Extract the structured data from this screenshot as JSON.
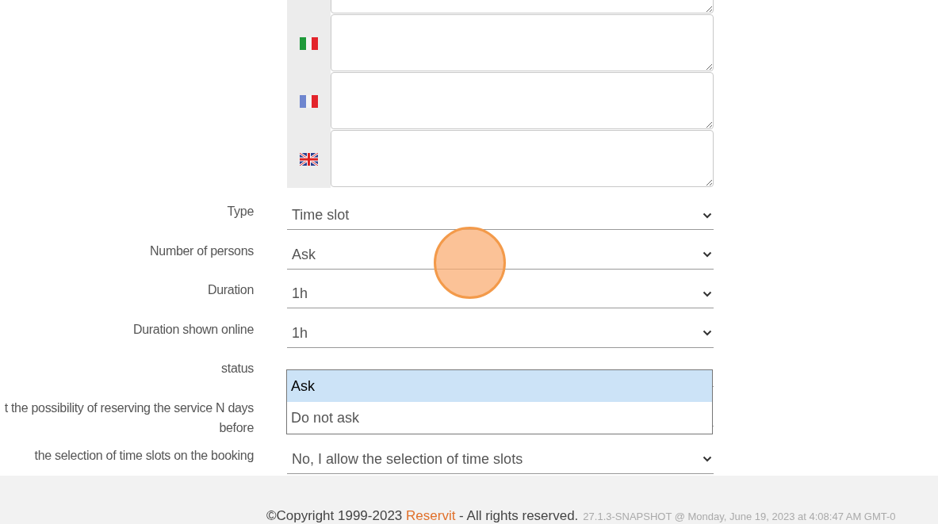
{
  "translations": [
    {
      "kind": "hidden"
    },
    {
      "kind": "italy"
    },
    {
      "kind": "france"
    },
    {
      "kind": "uk"
    }
  ],
  "fields": [
    {
      "label": "Type",
      "value": "Time slot"
    },
    {
      "label": "Number of persons",
      "value": "Ask"
    },
    {
      "label": "Duration",
      "value": "1h"
    },
    {
      "label": "Duration shown online",
      "value": "1h"
    },
    {
      "label": "status"
    },
    {
      "label": "t the possibility of reserving the service N days before"
    },
    {
      "label": "the selection of time slots on the booking",
      "value": "No, I allow the selection of time slots"
    }
  ],
  "dropdown": {
    "options": [
      {
        "label": "Ask",
        "selected": true
      },
      {
        "label": "Do not ask",
        "selected": false
      }
    ]
  },
  "footer": {
    "copyright": "©Copyright 1999-2023",
    "brand": "Reservit",
    "rights": "- All rights reserved.",
    "version": "27.1.3-SNAPSHOT @ Monday, June 19, 2023 at 4:08:47 AM GMT-0"
  }
}
